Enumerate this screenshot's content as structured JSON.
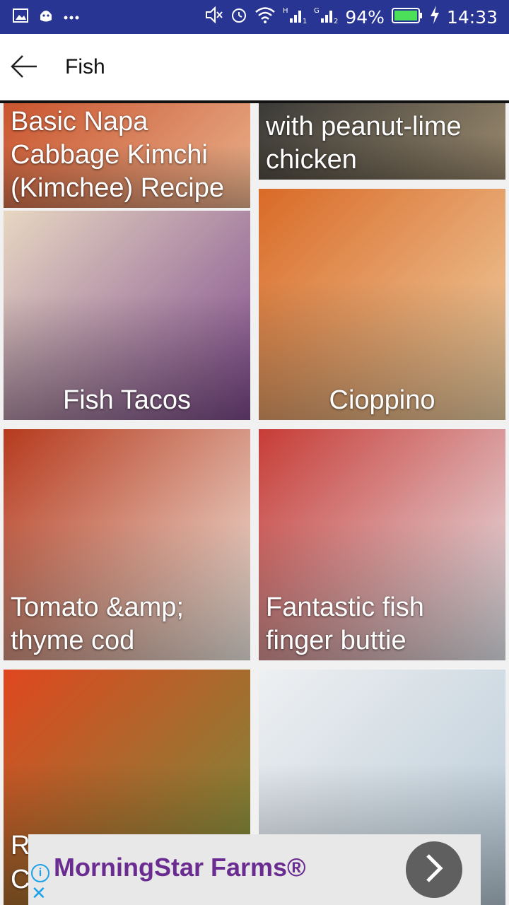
{
  "status_bar": {
    "battery": "94%",
    "time": "14:33",
    "icons": [
      "image-icon",
      "android-icon",
      "more-icon",
      "mute-icon",
      "alarm-icon",
      "wifi-icon",
      "signal-1-icon",
      "signal-2-icon",
      "battery-icon",
      "charging-icon"
    ]
  },
  "app_bar": {
    "title": "Fish",
    "back_icon": "arrow-left-icon"
  },
  "recipes": [
    {
      "title": "Basic Napa Cabbage Kimchi (Kimchee) Recipe",
      "colors": [
        "#c9552f",
        "#e9b28d"
      ]
    },
    {
      "title": "with peanut-lime chicken",
      "colors": [
        "#3b3a37",
        "#9c8b6f"
      ]
    },
    {
      "title": "Fish Tacos",
      "colors": [
        "#e8d7c2",
        "#7d4a8c"
      ]
    },
    {
      "title": "Cioppino",
      "colors": [
        "#d96a27",
        "#f1d4a8"
      ]
    },
    {
      "title": "Tomato &amp; thyme cod",
      "colors": [
        "#b63a1d",
        "#f3eee6"
      ]
    },
    {
      "title": "Fantastic fish finger buttie",
      "colors": [
        "#c73c36",
        "#e9eef4"
      ]
    },
    {
      "title": "R",
      "title_line2": "C",
      "colors": [
        "#e0471f",
        "#6f8f3c"
      ]
    },
    {
      "title": "",
      "colors": [
        "#eef0f2",
        "#b7c9d6"
      ]
    }
  ],
  "ad": {
    "title": "MorningStar Farms®",
    "info_icon": "info-icon",
    "close_icon": "close-icon",
    "cta_icon": "chevron-right-icon"
  }
}
